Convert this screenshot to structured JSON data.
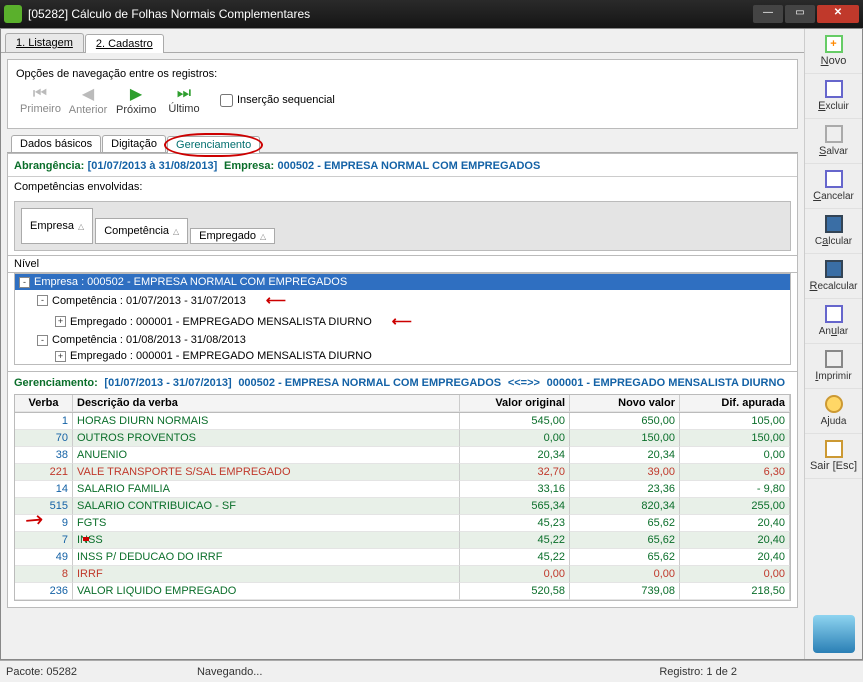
{
  "window": {
    "title": "[05282] Cálculo de Folhas Normais Complementares"
  },
  "tabs": {
    "listagem": "1. Listagem",
    "cadastro": "2. Cadastro"
  },
  "nav": {
    "label": "Opções de navegação entre os registros:",
    "primeiro": "Primeiro",
    "anterior": "Anterior",
    "proximo": "Próximo",
    "ultimo": "Último",
    "insercao": "Inserção sequencial"
  },
  "subtabs": {
    "dados": "Dados básicos",
    "digitacao": "Digitação",
    "gerenc": "Gerenciamento"
  },
  "abr": {
    "label": "Abrangência:",
    "range": "[01/07/2013 à 31/08/2013]",
    "emp_lbl": "Empresa:",
    "emp_val": "000502 - EMPRESA NORMAL COM EMPREGADOS"
  },
  "comp_env": "Competências envolvidas:",
  "groups": {
    "g1": "Empresa",
    "g2": "Competência",
    "g3": "Empregado"
  },
  "nivel": "Nível",
  "tree": {
    "root": "Empresa : 000502 - EMPRESA NORMAL COM EMPREGADOS",
    "c1": "Competência : 01/07/2013 - 31/07/2013",
    "e1": "Empregado : 000001 - EMPREGADO MENSALISTA DIURNO",
    "c2": "Competência : 01/08/2013 - 31/08/2013",
    "e2": "Empregado : 000001 - EMPREGADO MENSALISTA DIURNO"
  },
  "ger": {
    "lbl": "Gerenciamento:",
    "range": "[01/07/2013 - 31/07/2013]",
    "emp": "000502 - EMPRESA NORMAL COM EMPREGADOS",
    "sep": "<<=>>",
    "det": "000001 - EMPREGADO MENSALISTA DIURNO"
  },
  "grid": {
    "headers": {
      "verba": "Verba",
      "desc": "Descrição da verba",
      "v1": "Valor original",
      "v2": "Novo valor",
      "v3": "Dif. apurada"
    },
    "rows": [
      {
        "verba": "1",
        "desc": "HORAS DIURN NORMAIS",
        "v1": "545,00",
        "v2": "650,00",
        "v3": "105,00",
        "red": false
      },
      {
        "verba": "70",
        "desc": "OUTROS PROVENTOS",
        "v1": "0,00",
        "v2": "150,00",
        "v3": "150,00",
        "red": false
      },
      {
        "verba": "38",
        "desc": "ANUENIO",
        "v1": "20,34",
        "v2": "20,34",
        "v3": "0,00",
        "red": false
      },
      {
        "verba": "221",
        "desc": "VALE TRANSPORTE S/SAL EMPREGADO",
        "v1": "32,70",
        "v2": "39,00",
        "v3": "6,30",
        "red": true
      },
      {
        "verba": "14",
        "desc": "SALARIO FAMILIA",
        "v1": "33,16",
        "v2": "23,36",
        "v3": "- 9,80",
        "red": false
      },
      {
        "verba": "515",
        "desc": "SALARIO CONTRIBUICAO - SF",
        "v1": "565,34",
        "v2": "820,34",
        "v3": "255,00",
        "red": false
      },
      {
        "verba": "9",
        "desc": "FGTS",
        "v1": "45,23",
        "v2": "65,62",
        "v3": "20,40",
        "red": false
      },
      {
        "verba": "7",
        "desc": "INSS",
        "v1": "45,22",
        "v2": "65,62",
        "v3": "20,40",
        "red": false
      },
      {
        "verba": "49",
        "desc": "INSS P/ DEDUCAO DO IRRF",
        "v1": "45,22",
        "v2": "65,62",
        "v3": "20,40",
        "red": false
      },
      {
        "verba": "8",
        "desc": "IRRF",
        "v1": "0,00",
        "v2": "0,00",
        "v3": "0,00",
        "red": true
      },
      {
        "verba": "236",
        "desc": "VALOR LIQUIDO EMPREGADO",
        "v1": "520,58",
        "v2": "739,08",
        "v3": "218,50",
        "red": false
      }
    ]
  },
  "side": {
    "novo": "Novo",
    "excluir": "Excluir",
    "salvar": "Salvar",
    "cancelar": "Cancelar",
    "calcular": "Calcular",
    "recalcular": "Recalcular",
    "anular": "Anular",
    "imprimir": "Imprimir",
    "ajuda": "Ajuda",
    "sair": "Sair [Esc]"
  },
  "status": {
    "pacote": "Pacote: 05282",
    "nav": "Navegando...",
    "reg": "Registro: 1 de 2"
  }
}
